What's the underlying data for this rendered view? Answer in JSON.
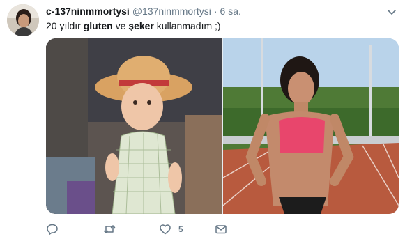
{
  "tweet": {
    "author": {
      "display_name": "c-137ninmmortysi",
      "handle": "@137ninmmortysi",
      "separator": "·",
      "time": "6 sa."
    },
    "text": {
      "part1": "20 yıldır ",
      "bold1": "gluten",
      "part2": " ve ",
      "bold2": "şeker",
      "part3": " kullanmadım ;)"
    },
    "media": [
      {
        "icon": "photo-baby-straw-hat"
      },
      {
        "icon": "photo-athlete-track"
      }
    ],
    "actions": {
      "reply": {
        "icon": "reply-icon",
        "count": ""
      },
      "retweet": {
        "icon": "retweet-icon",
        "count": ""
      },
      "like": {
        "icon": "heart-icon",
        "count": "5"
      },
      "message": {
        "icon": "envelope-icon",
        "count": ""
      }
    },
    "colors": {
      "text_primary": "#14171a",
      "text_secondary": "#657786",
      "background": "#ffffff"
    }
  }
}
